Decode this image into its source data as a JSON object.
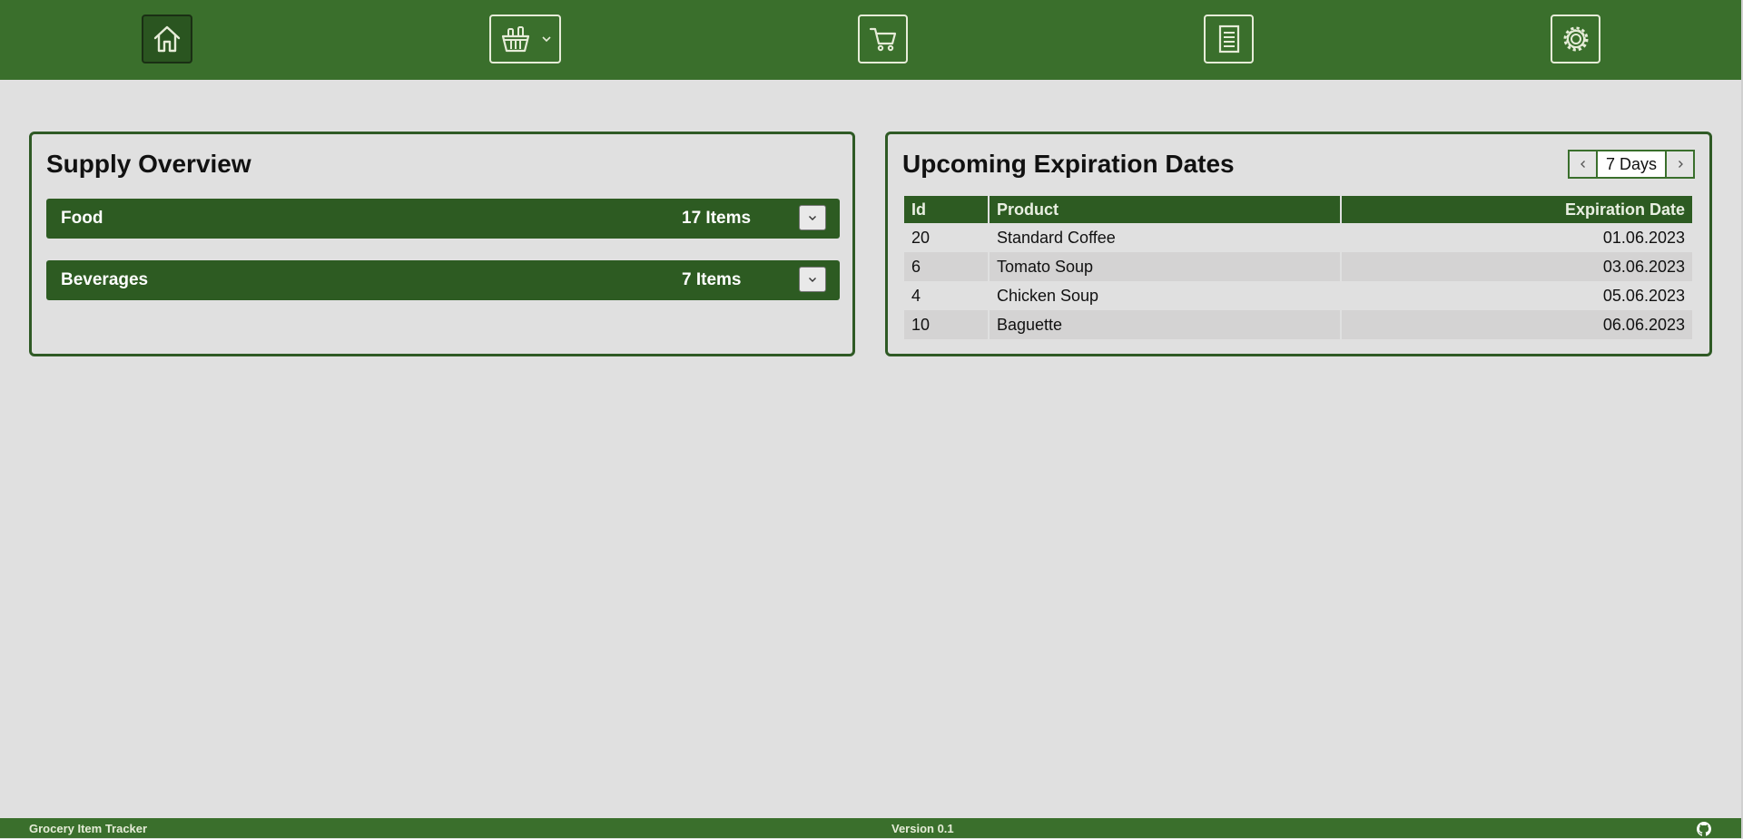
{
  "nav": {
    "items": [
      {
        "name": "home",
        "icon": "home-icon"
      },
      {
        "name": "supplies",
        "icon": "basket-icon"
      },
      {
        "name": "shopping-cart",
        "icon": "cart-icon"
      },
      {
        "name": "list",
        "icon": "document-icon"
      },
      {
        "name": "settings",
        "icon": "gear-icon"
      }
    ]
  },
  "supply_overview": {
    "title": "Supply Overview",
    "categories": [
      {
        "name": "Food",
        "count": "17 Items"
      },
      {
        "name": "Beverages",
        "count": "7 Items"
      }
    ]
  },
  "expiration": {
    "title": "Upcoming Expiration Dates",
    "period": "7 Days",
    "columns": {
      "id": "Id",
      "product": "Product",
      "date": "Expiration Date"
    },
    "rows": [
      {
        "id": "20",
        "product": "Standard Coffee",
        "date": "01.06.2023"
      },
      {
        "id": "6",
        "product": "Tomato Soup",
        "date": "03.06.2023"
      },
      {
        "id": "4",
        "product": "Chicken Soup",
        "date": "05.06.2023"
      },
      {
        "id": "10",
        "product": "Baguette",
        "date": "06.06.2023"
      }
    ]
  },
  "footer": {
    "app_name": "Grocery Item Tracker",
    "version": "Version 0.1",
    "github_icon": "github-icon"
  },
  "colors": {
    "primary": "#3a6f2c",
    "primary_dark": "#2d5b22",
    "background": "#e0e0e0"
  }
}
